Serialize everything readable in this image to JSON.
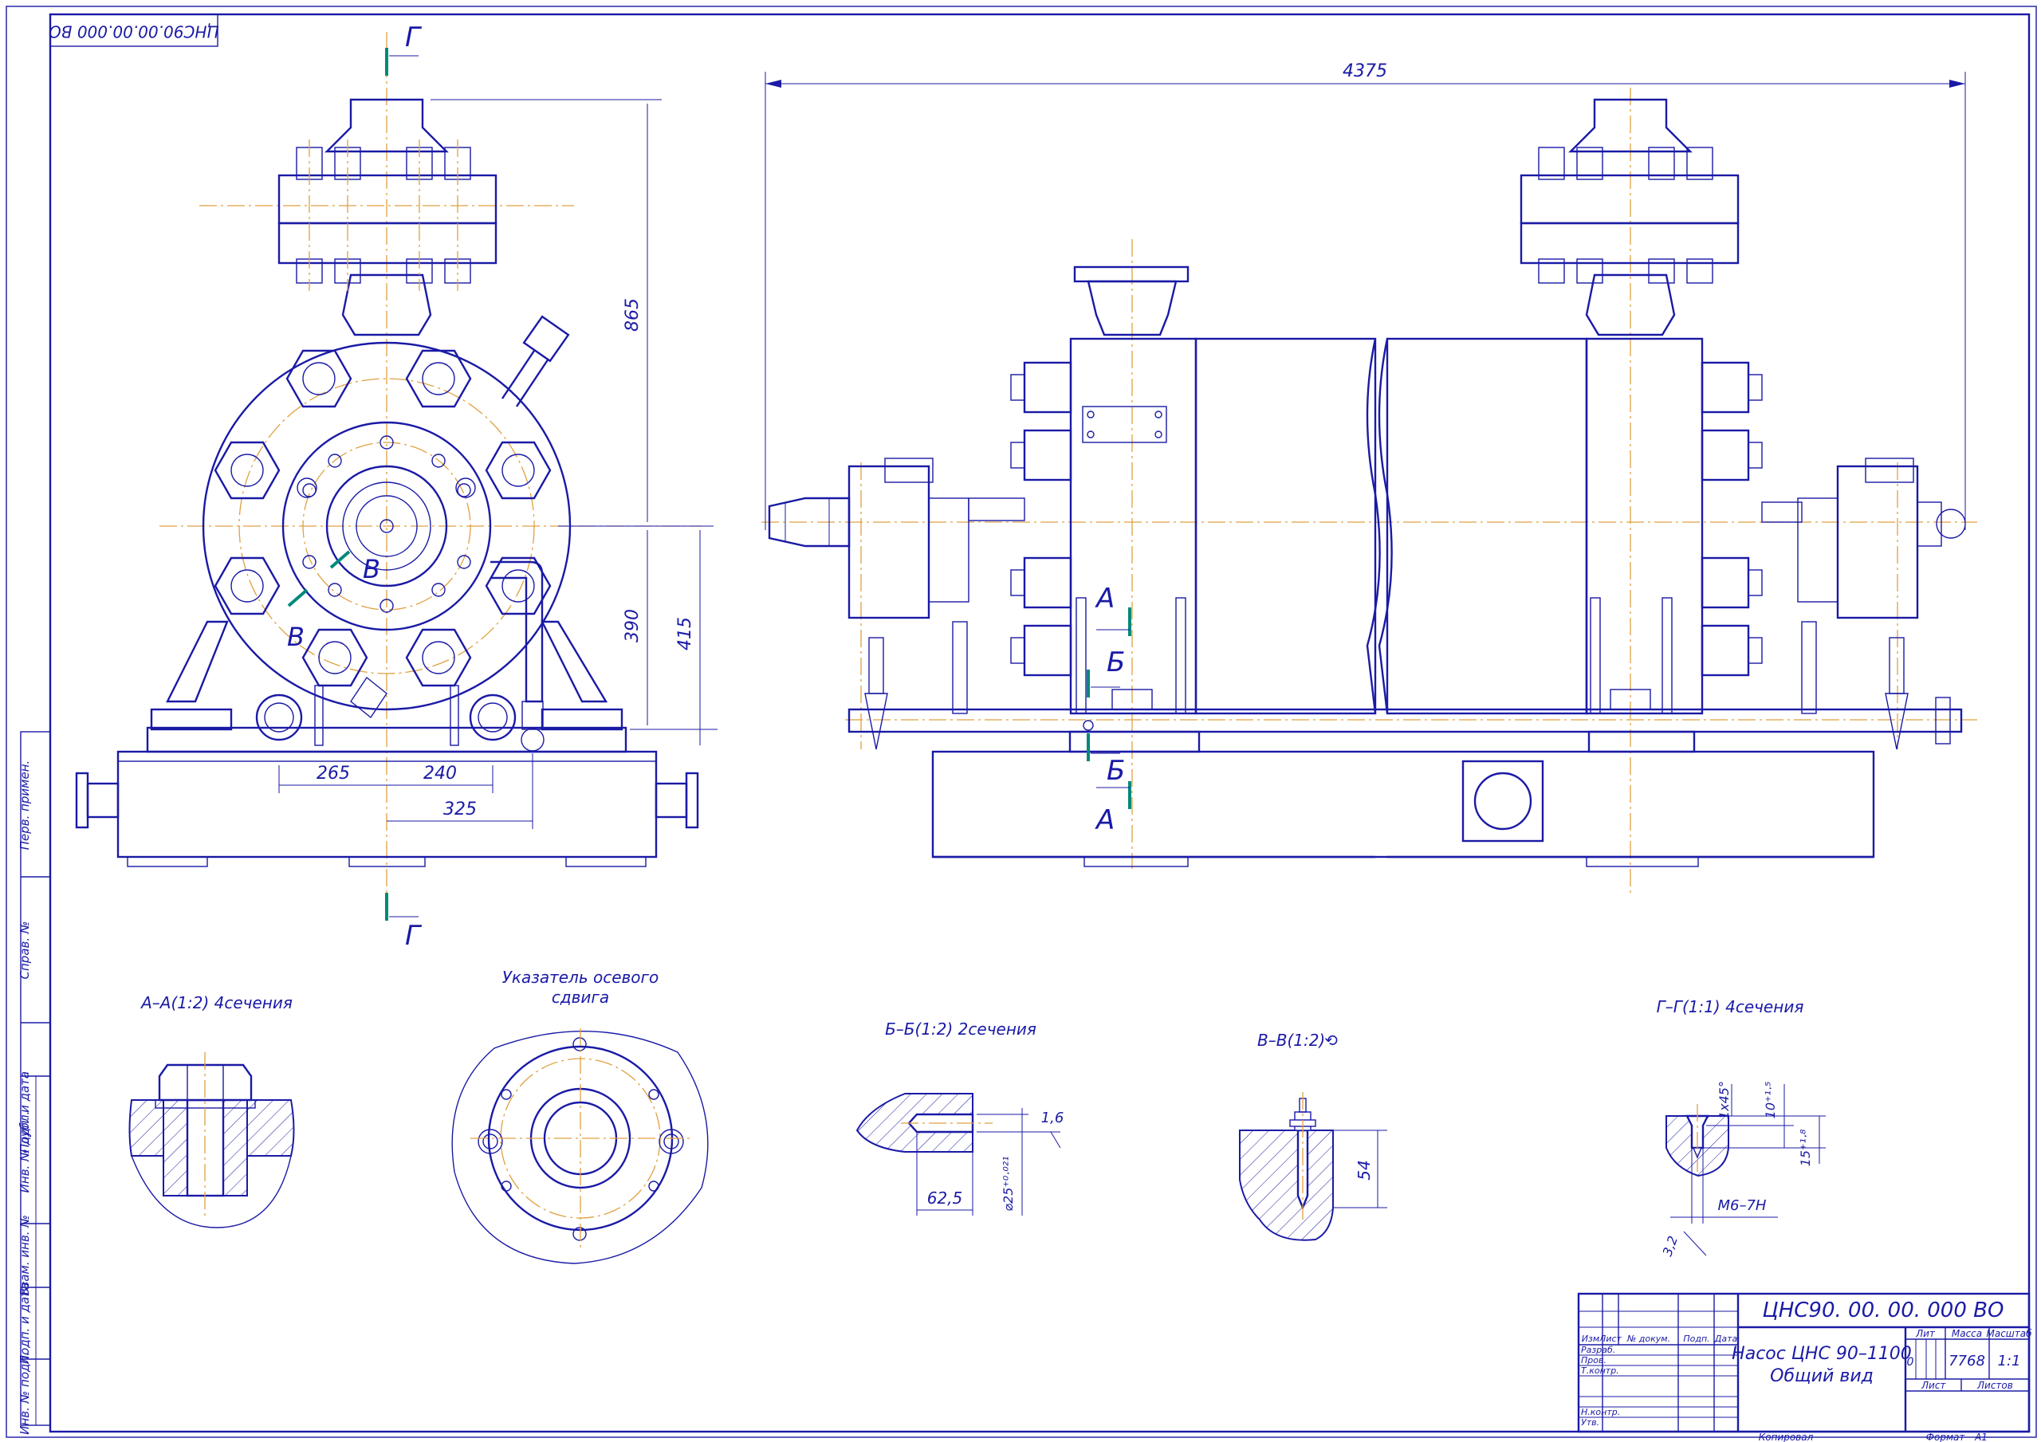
{
  "sheet": {
    "stamp_code": "ЦНС90.00.00.000 ВО",
    "colors": {
      "lines": "#1a1aa6",
      "axis": "#e0a040",
      "cutline": "#00897b"
    }
  },
  "dimensions": {
    "overall_length": "4375",
    "height_865": "865",
    "height_390": "390",
    "height_415": "415",
    "width_265": "265",
    "width_240": "240",
    "width_325": "325"
  },
  "section_marks": {
    "g": "Г",
    "v": "В",
    "a": "А",
    "b": "Б"
  },
  "views": {
    "section_aa": {
      "title": "А–А(1:2) 4сечения"
    },
    "indicator": {
      "title_line1": "Указатель осевого",
      "title_line2": "сдвига"
    },
    "section_bb": {
      "title": "Б–Б(1:2) 2сечения",
      "dim_625": "62,5",
      "dim_diam": "⌀25⁺⁰·⁰²¹",
      "roughness": "1,6"
    },
    "section_vv": {
      "title": "В–В(1:2)⟲",
      "dim_54": "54"
    },
    "section_gg": {
      "title": "Г–Г(1:1) 4сечения",
      "chamfer": "1х45°",
      "depth_10": "10⁺¹·⁵",
      "depth_15": "15⁺¹·⁸",
      "thread": "М6–7Н",
      "dim_32": "3,2"
    }
  },
  "side_strip": {
    "labels": [
      "Перв. примен.",
      "Справ. №",
      "Подп. и дата",
      "Инв. № дубл.",
      "Взам. инв. №",
      "Подп. и дата",
      "Инв. № подл."
    ]
  },
  "title_block": {
    "code": "ЦНС90. 00. 00. 000 ВО",
    "name_line1": "Насос ЦНС 90–1100",
    "name_line2": "Общий вид",
    "col_headers": {
      "izm": "Изм",
      "list": "Лист",
      "ndoc": "№ докум.",
      "podp": "Подп.",
      "data": "Дата"
    },
    "rows": [
      "Разраб.",
      "Пров.",
      "Т.контр.",
      "",
      "Н.контр.",
      "Утв."
    ],
    "lit": "Лит",
    "massa": "Масса",
    "masshtab": "Масштаб",
    "lit_value": "0",
    "massa_value": "7768",
    "masshtab_value": "1:1",
    "list": "Лист",
    "listov": "Листов",
    "kopiroval": "Копировал",
    "format": "Формат",
    "format_value": "А1"
  }
}
